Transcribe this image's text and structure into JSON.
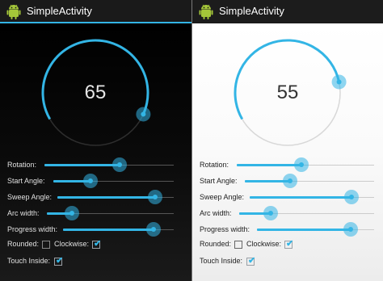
{
  "accent_color": "#33b5e5",
  "app": {
    "title": "SimpleActivity",
    "icon": "android-robot-icon"
  },
  "panels": [
    {
      "theme": "dark",
      "arc_value": "65",
      "progress": 0.65,
      "controls": {
        "rotation": {
          "label": "Rotation:",
          "value": 0.58
        },
        "start_angle": {
          "label": "Start Angle:",
          "value": 0.31
        },
        "sweep_angle": {
          "label": "Sweep Angle:",
          "value": 0.93
        },
        "arc_width": {
          "label": "Arc width:",
          "value": 0.2
        },
        "progress_width": {
          "label": "Progress width:",
          "value": 0.94
        },
        "rounded": {
          "label": "Rounded:",
          "checked": false
        },
        "clockwise": {
          "label": "Clockwise:",
          "checked": true
        },
        "touch_inside": {
          "label": "Touch Inside:",
          "checked": true
        }
      }
    },
    {
      "theme": "light",
      "arc_value": "55",
      "progress": 0.55,
      "controls": {
        "rotation": {
          "label": "Rotation:",
          "value": 0.5
        },
        "start_angle": {
          "label": "Start Angle:",
          "value": 0.37
        },
        "sweep_angle": {
          "label": "Sweep Angle:",
          "value": 0.94
        },
        "arc_width": {
          "label": "Arc width:",
          "value": 0.25
        },
        "progress_width": {
          "label": "Progress width:",
          "value": 0.93
        },
        "rounded": {
          "label": "Rounded:",
          "checked": false
        },
        "clockwise": {
          "label": "Clockwise:",
          "checked": true
        },
        "touch_inside": {
          "label": "Touch Inside:",
          "checked": true
        }
      }
    }
  ]
}
